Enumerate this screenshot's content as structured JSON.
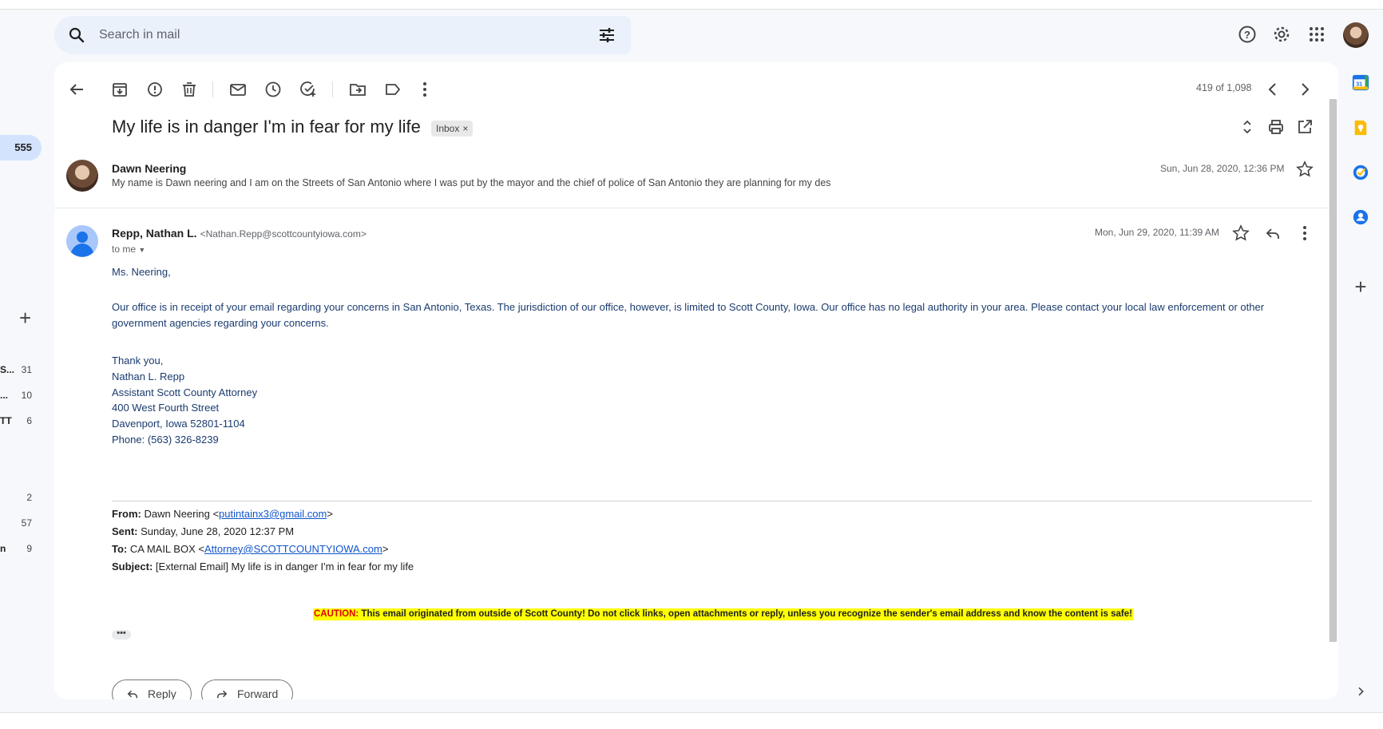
{
  "sidebar": {
    "inbox_count": "555",
    "rows": [
      {
        "label": "S...",
        "count": "31"
      },
      {
        "label": "...",
        "count": "10"
      },
      {
        "label": "TT",
        "count": "6"
      },
      {
        "label": "",
        "count": "2"
      },
      {
        "label": "",
        "count": "57"
      },
      {
        "label": "n",
        "count": "9"
      }
    ]
  },
  "search": {
    "placeholder": "Search in mail"
  },
  "toolbar": {
    "pager": "419 of 1,098"
  },
  "thread": {
    "subject": "My life is in danger I'm in fear for my life",
    "label_chip": "Inbox",
    "chip_close": "×"
  },
  "message1": {
    "sender": "Dawn Neering",
    "snippet": "My name is Dawn neering and I am on the Streets of San Antonio where I was put by the mayor and the chief of police of San Antonio they are planning for my des",
    "date": "Sun, Jun 28, 2020, 12:36 PM"
  },
  "message2": {
    "sender": "Repp, Nathan L.",
    "email": "<Nathan.Repp@scottcountyiowa.com>",
    "to": "to me",
    "date": "Mon, Jun 29, 2020, 11:39 AM",
    "greeting": "Ms. Neering,",
    "para1": "Our office is in receipt of your email regarding your concerns in San Antonio, Texas.  The jurisdiction of our office, however, is limited to Scott County, Iowa.  Our office has no legal authority in your area.  Please contact your local law enforcement or other government agencies regarding your concerns.",
    "sig": [
      "Thank you,",
      "Nathan L. Repp",
      "Assistant Scott County Attorney",
      "400 West Fourth Street",
      "Davenport, Iowa 52801-1104",
      "Phone: (563) 326-8239"
    ],
    "fw_from_label": "From:",
    "fw_from_name": " Dawn Neering <",
    "fw_from_email": "putintainx3@gmail.com",
    "fw_from_end": ">",
    "fw_sent_label": "Sent:",
    "fw_sent": " Sunday, June 28, 2020 12:37 PM",
    "fw_to_label": "To:",
    "fw_to_name": " CA MAIL BOX <",
    "fw_to_email": "Attorney@SCOTTCOUNTYIOWA.com",
    "fw_to_end": ">",
    "fw_subject_label": "Subject:",
    "fw_subject": " [External Email] My life is in danger I'm in fear for my life",
    "caution_label": "CAUTION:",
    "caution_text": " This email originated from outside of Scott County! Do not click links, open attachments or reply, unless you recognize the sender's email address and know the content is safe!",
    "dots": "•••"
  },
  "actions": {
    "reply": "Reply",
    "forward": "Forward"
  },
  "colors": {
    "accent": "#0b57d0",
    "body_text": "#1a3b6e",
    "caution_bg": "#ffff00",
    "caution_red": "#e00000"
  }
}
